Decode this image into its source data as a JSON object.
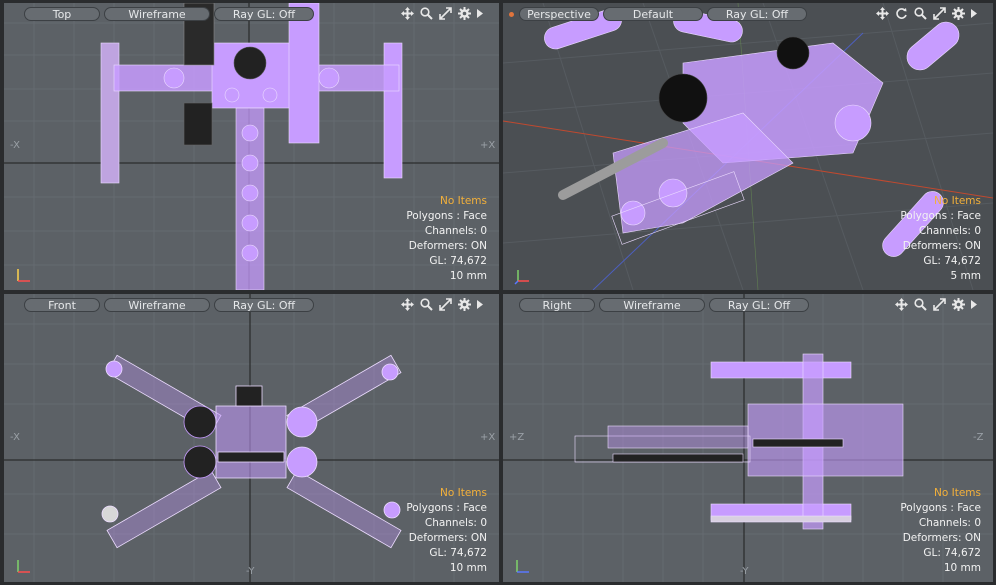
{
  "viewports": {
    "top": {
      "view": "Top",
      "shading": "Wireframe",
      "raygl": "Ray GL: Off",
      "info": {
        "no_items": "No Items",
        "polygons": "Polygons : Face",
        "channels": "Channels: 0",
        "deformers": "Deformers: ON",
        "gl": "GL: 74,672",
        "scale": "10 mm"
      },
      "axes": {
        "left": "-X",
        "right": "+X"
      }
    },
    "perspective": {
      "view": "Perspective",
      "shading": "Default",
      "raygl": "Ray GL: Off",
      "info": {
        "no_items": "No Items",
        "polygons": "Polygons : Face",
        "channels": "Channels: 0",
        "deformers": "Deformers: ON",
        "gl": "GL: 74,672",
        "scale": "5 mm"
      }
    },
    "front": {
      "view": "Front",
      "shading": "Wireframe",
      "raygl": "Ray GL: Off",
      "info": {
        "no_items": "No Items",
        "polygons": "Polygons : Face",
        "channels": "Channels: 0",
        "deformers": "Deformers: ON",
        "gl": "GL: 74,672",
        "scale": "10 mm"
      },
      "axes": {
        "left": "-X",
        "right": "+X",
        "bottom": "-Y"
      }
    },
    "right": {
      "view": "Right",
      "shading": "Wireframe",
      "raygl": "Ray GL: Off",
      "info": {
        "no_items": "No Items",
        "polygons": "Polygons : Face",
        "channels": "Channels: 0",
        "deformers": "Deformers: ON",
        "gl": "GL: 74,672",
        "scale": "10 mm"
      },
      "axes": {
        "left": "+Z",
        "right": "-Z",
        "bottom": "-Y"
      }
    }
  },
  "icons": [
    "move-icon",
    "zoom-icon",
    "fit-icon",
    "settings-icon",
    "menu-arrow-icon",
    "rotate-icon"
  ],
  "colors": {
    "viewport_bg": "#5c6166",
    "grid": "#656a70",
    "axis": "#1e1e1e",
    "model": "#c79cff",
    "info_highlight": "#f3b03a"
  }
}
